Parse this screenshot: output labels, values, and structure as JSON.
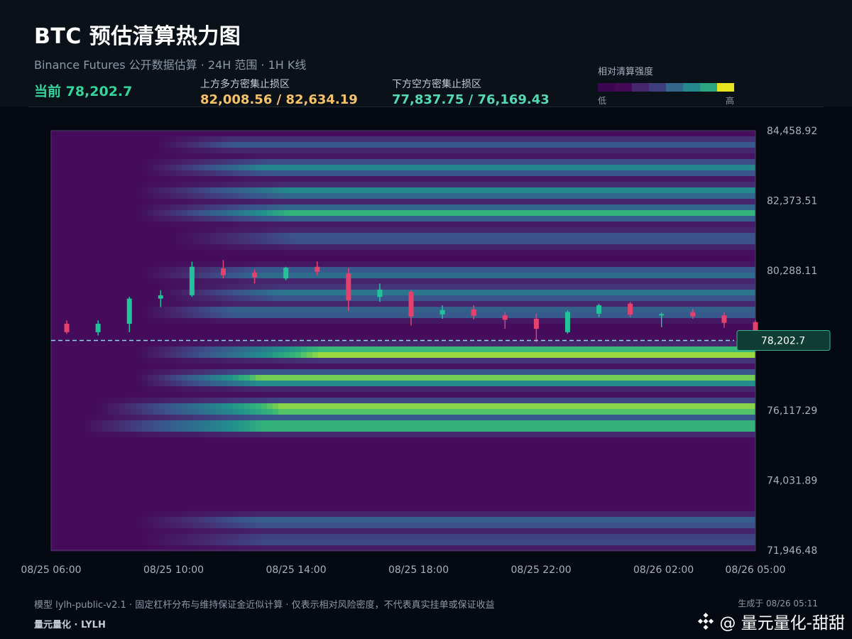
{
  "header": {
    "title": "BTC 预估清算热力图",
    "subtitle": "Binance Futures 公开数据估算 · 24H 范围 · 1H K线",
    "current_label": "当前 78,202.7",
    "upper_zone_label": "上方多方密集止损区",
    "upper_zone_value": "82,008.56 / 82,634.19",
    "lower_zone_label": "下方空方密集止损区",
    "lower_zone_value": "77,837.75 / 76,169.43"
  },
  "legend": {
    "label": "相对清算强度",
    "low": "低",
    "high": "高",
    "colors": [
      "#3b0751",
      "#440a58",
      "#46266d",
      "#3e3e7c",
      "#33668b",
      "#23898c",
      "#2ba57f",
      "#e6e31f"
    ]
  },
  "colors": {
    "up": "#22c39a",
    "down": "#e5416f",
    "current_line": "#8fd6e6",
    "price_tag_bg": "#0f3d34",
    "price_tag_border": "#3fae8c"
  },
  "footer": {
    "model_note": "模型 lylh-public-v2.1 · 固定杠杆分布与维持保证金近似计算 · 仅表示相对风险密度，不代表真实挂单或保证收益",
    "brand": "量元量化 · LYLH",
    "generated": "生成于 08/26 05:11",
    "watermark": "@ 量元量化-甜甜"
  },
  "chart_data": {
    "type": "heatmap",
    "y_range": [
      71946.48,
      84458.92
    ],
    "y_ticks": [
      {
        "v": 84458.92,
        "label": "84,458.92"
      },
      {
        "v": 82373.51,
        "label": "82,373.51"
      },
      {
        "v": 80288.11,
        "label": "80,288.11"
      },
      {
        "v": 78202.7,
        "label": "78,202.7"
      },
      {
        "v": 76117.29,
        "label": "76,117.29"
      },
      {
        "v": 74031.89,
        "label": "74,031.89"
      },
      {
        "v": 71946.48,
        "label": "71,946.48"
      }
    ],
    "x_range_hours": [
      0,
      23
    ],
    "x_ticks": [
      {
        "h": 0,
        "label": "08/25 06:00"
      },
      {
        "h": 4,
        "label": "08/25 10:00"
      },
      {
        "h": 8,
        "label": "08/25 14:00"
      },
      {
        "h": 12,
        "label": "08/25 18:00"
      },
      {
        "h": 16,
        "label": "08/25 22:00"
      },
      {
        "h": 20,
        "label": "08/26 02:00"
      },
      {
        "h": 23,
        "label": "08/26 05:00"
      }
    ],
    "current_price": 78202.7,
    "current_price_label": "78,202.7",
    "candles": [
      {
        "o": 78700,
        "h": 78800,
        "l": 78400,
        "c": 78450
      },
      {
        "o": 78450,
        "h": 78800,
        "l": 78350,
        "c": 78700
      },
      {
        "o": 78700,
        "h": 79500,
        "l": 78450,
        "c": 79450
      },
      {
        "o": 79450,
        "h": 79700,
        "l": 79200,
        "c": 79550
      },
      {
        "o": 79550,
        "h": 80550,
        "l": 79500,
        "c": 80400
      },
      {
        "o": 80350,
        "h": 80600,
        "l": 80050,
        "c": 80150
      },
      {
        "o": 80230,
        "h": 80320,
        "l": 79900,
        "c": 80080
      },
      {
        "o": 80050,
        "h": 80400,
        "l": 80000,
        "c": 80370
      },
      {
        "o": 80400,
        "h": 80560,
        "l": 80150,
        "c": 80250
      },
      {
        "o": 80200,
        "h": 80360,
        "l": 79080,
        "c": 79400
      },
      {
        "o": 79500,
        "h": 79900,
        "l": 79350,
        "c": 79720
      },
      {
        "o": 79650,
        "h": 79700,
        "l": 78650,
        "c": 78920
      },
      {
        "o": 78980,
        "h": 79250,
        "l": 78850,
        "c": 79110
      },
      {
        "o": 79130,
        "h": 79250,
        "l": 78830,
        "c": 78940
      },
      {
        "o": 78950,
        "h": 79050,
        "l": 78550,
        "c": 78820
      },
      {
        "o": 78850,
        "h": 79000,
        "l": 78150,
        "c": 78550
      },
      {
        "o": 78450,
        "h": 79100,
        "l": 78400,
        "c": 79050
      },
      {
        "o": 79000,
        "h": 79300,
        "l": 78900,
        "c": 79250
      },
      {
        "o": 79300,
        "h": 79350,
        "l": 78900,
        "c": 78970
      },
      {
        "o": 78950,
        "h": 79030,
        "l": 78600,
        "c": 78990
      },
      {
        "o": 79050,
        "h": 79150,
        "l": 78850,
        "c": 78920
      },
      {
        "o": 78950,
        "h": 79050,
        "l": 78580,
        "c": 78730
      },
      {
        "o": 78750,
        "h": 78800,
        "l": 78150,
        "c": 78180
      }
    ],
    "bands": [
      {
        "v": 84050,
        "w": 130,
        "s": 0.34,
        "start": 3.5,
        "grow": 2.5
      },
      {
        "v": 83350,
        "w": 150,
        "s": 0.56,
        "start": 3.0,
        "grow": 4.0
      },
      {
        "v": 82630,
        "w": 130,
        "s": 0.62,
        "start": 2.8,
        "grow": 5.0
      },
      {
        "v": 82010,
        "w": 150,
        "s": 0.74,
        "start": 2.8,
        "grow": 5.0
      },
      {
        "v": 81250,
        "w": 170,
        "s": 0.34,
        "start": 4.0,
        "grow": 4.0
      },
      {
        "v": 80200,
        "w": 130,
        "s": 0.48,
        "start": 3.0,
        "grow": 4.0
      },
      {
        "v": 79600,
        "w": 140,
        "s": 0.5,
        "start": 3.5,
        "grow": 4.0
      },
      {
        "v": 79050,
        "w": 130,
        "s": 0.44,
        "start": 3.0,
        "grow": 3.0
      },
      {
        "v": 77840,
        "w": 130,
        "s": 1.0,
        "start": 2.8,
        "grow": 6.0
      },
      {
        "v": 77050,
        "w": 150,
        "s": 0.85,
        "start": 2.8,
        "grow": 4.0
      },
      {
        "v": 76170,
        "w": 150,
        "s": 0.95,
        "start": 1.5,
        "grow": 6.0
      },
      {
        "v": 75650,
        "w": 130,
        "s": 0.9,
        "start": 1.0,
        "grow": 6.0
      },
      {
        "v": 72800,
        "w": 140,
        "s": 0.4,
        "start": 2.8,
        "grow": 4.0
      },
      {
        "v": 72250,
        "w": 140,
        "s": 0.3,
        "start": 3.0,
        "grow": 4.0
      }
    ]
  }
}
